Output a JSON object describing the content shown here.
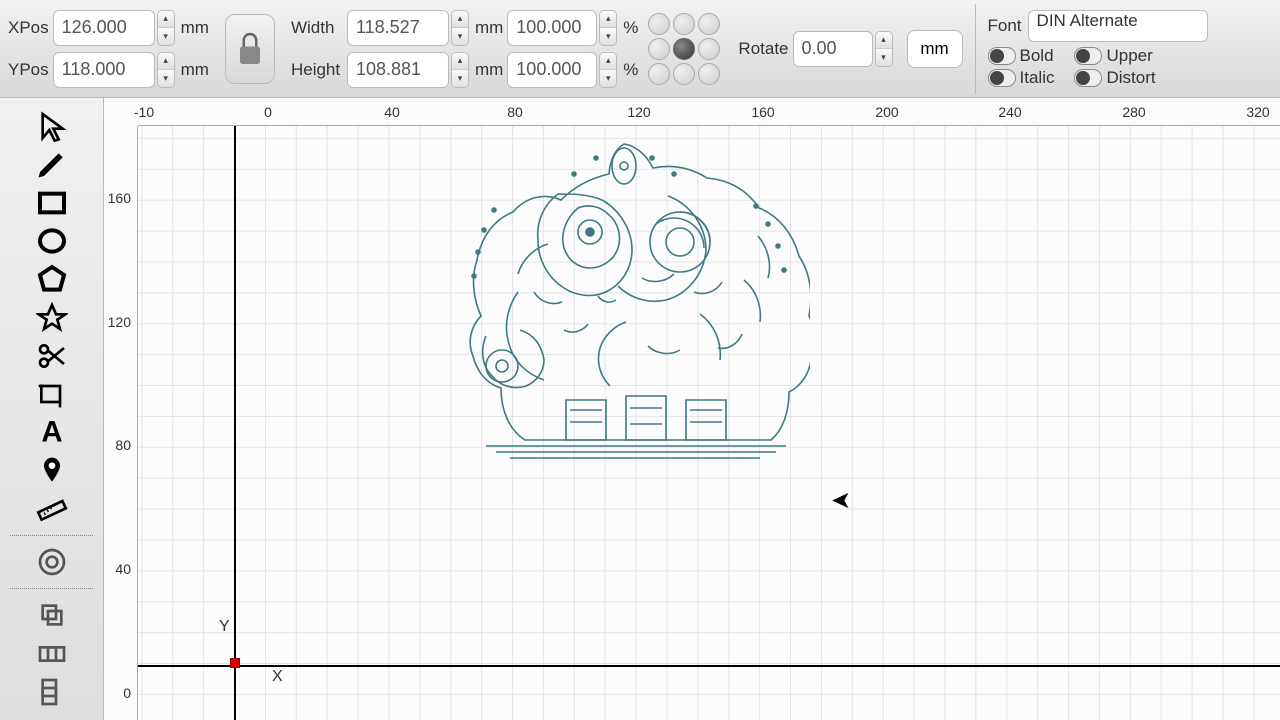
{
  "toolbar": {
    "xpos_label": "XPos",
    "xpos_value": "126.000",
    "xpos_unit": "mm",
    "ypos_label": "YPos",
    "ypos_value": "118.000",
    "ypos_unit": "mm",
    "width_label": "Width",
    "width_value": "118.527",
    "width_unit": "mm",
    "width_pct": "100.000",
    "width_pct_unit": "%",
    "height_label": "Height",
    "height_value": "108.881",
    "height_unit": "mm",
    "height_pct": "100.000",
    "height_pct_unit": "%",
    "rotate_label": "Rotate",
    "rotate_value": "0.00",
    "mm_btn": "mm",
    "font_label": "Font",
    "font_value": "DIN Alternate",
    "bold_label": "Bold",
    "italic_label": "Italic",
    "upper_label": "Upper",
    "distort_label": "Distort"
  },
  "ruler": {
    "h": [
      "-10",
      "0",
      "40",
      "80",
      "120",
      "160",
      "200",
      "240",
      "280",
      "320"
    ],
    "v": [
      "160",
      "120",
      "80",
      "40",
      "0"
    ]
  },
  "axis": {
    "x": "X",
    "y": "Y"
  }
}
